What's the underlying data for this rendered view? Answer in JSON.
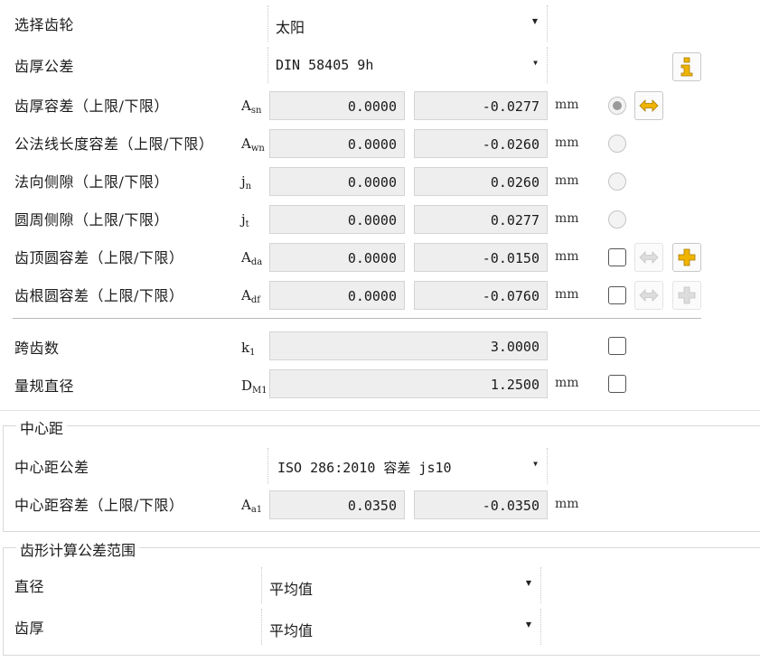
{
  "gear": {
    "label": "选择齿轮",
    "value": "太阳"
  },
  "thickness_tolerance": {
    "label": "齿厚公差",
    "value": "DIN 58405 9h"
  },
  "rows": [
    {
      "label": "齿厚容差（上限/下限）",
      "sym": "A",
      "sub": "sn",
      "upper": "0.0000",
      "lower": "-0.0277",
      "unit": "mm"
    },
    {
      "label": "公法线长度容差（上限/下限）",
      "sym": "A",
      "sub": "wn",
      "upper": "0.0000",
      "lower": "-0.0260",
      "unit": "mm"
    },
    {
      "label": "法向侧隙（上限/下限）",
      "sym": "j",
      "sub": "n",
      "upper": "0.0000",
      "lower": "0.0260",
      "unit": "mm"
    },
    {
      "label": "圆周侧隙（上限/下限）",
      "sym": "j",
      "sub": "t",
      "upper": "0.0000",
      "lower": "0.0277",
      "unit": "mm"
    },
    {
      "label": "齿顶圆容差（上限/下限）",
      "sym": "A",
      "sub": "da",
      "upper": "0.0000",
      "lower": "-0.0150",
      "unit": "mm"
    },
    {
      "label": "齿根圆容差（上限/下限）",
      "sym": "A",
      "sub": "df",
      "upper": "0.0000",
      "lower": "-0.0760",
      "unit": "mm"
    }
  ],
  "span": {
    "label": "跨齿数",
    "sym": "k",
    "sub": "1",
    "value": "3.0000"
  },
  "pin": {
    "label": "量规直径",
    "sym": "D",
    "sub": "M1",
    "value": "1.2500",
    "unit": "mm"
  },
  "center": {
    "title": "中心距",
    "tol_label": "中心距公差",
    "tol_value": "ISO 286:2010 容差 js10",
    "row": {
      "label": "中心距容差（上限/下限）",
      "sym": "A",
      "sub": "a1",
      "upper": "0.0350",
      "lower": "-0.0350",
      "unit": "mm"
    }
  },
  "profile": {
    "title": "齿形计算公差范围",
    "diameter_label": "直径",
    "diameter_value": "平均值",
    "thickness_label": "齿厚",
    "thickness_value": "平均值"
  },
  "icons": {
    "info": "info-icon",
    "swap": "double-arrow-icon",
    "plus": "plus-icon",
    "accent": "#f0b400"
  }
}
